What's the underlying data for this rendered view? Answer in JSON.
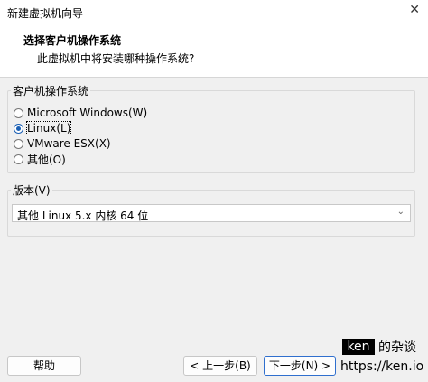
{
  "window": {
    "title": "新建虚拟机向导",
    "close_glyph": "✕"
  },
  "header": {
    "title": "选择客户机操作系统",
    "subtitle": "此虚拟机中将安装哪种操作系统?"
  },
  "os_group": {
    "label": "客户机操作系统",
    "options": [
      {
        "label": "Microsoft Windows(W)",
        "checked": false
      },
      {
        "label": "Linux(L)",
        "checked": true
      },
      {
        "label": "VMware ESX(X)",
        "checked": false
      },
      {
        "label": "其他(O)",
        "checked": false
      }
    ]
  },
  "version_group": {
    "label": "版本(V)",
    "selected": "其他 Linux 5.x 内核 64 位",
    "arrow_glyph": "⌄"
  },
  "buttons": {
    "help": "帮助",
    "back": "< 上一步(B)",
    "next": "下一步(N) >"
  },
  "watermark": {
    "logo": "ken",
    "tagline": "的杂谈",
    "url": "https://ken.io"
  }
}
